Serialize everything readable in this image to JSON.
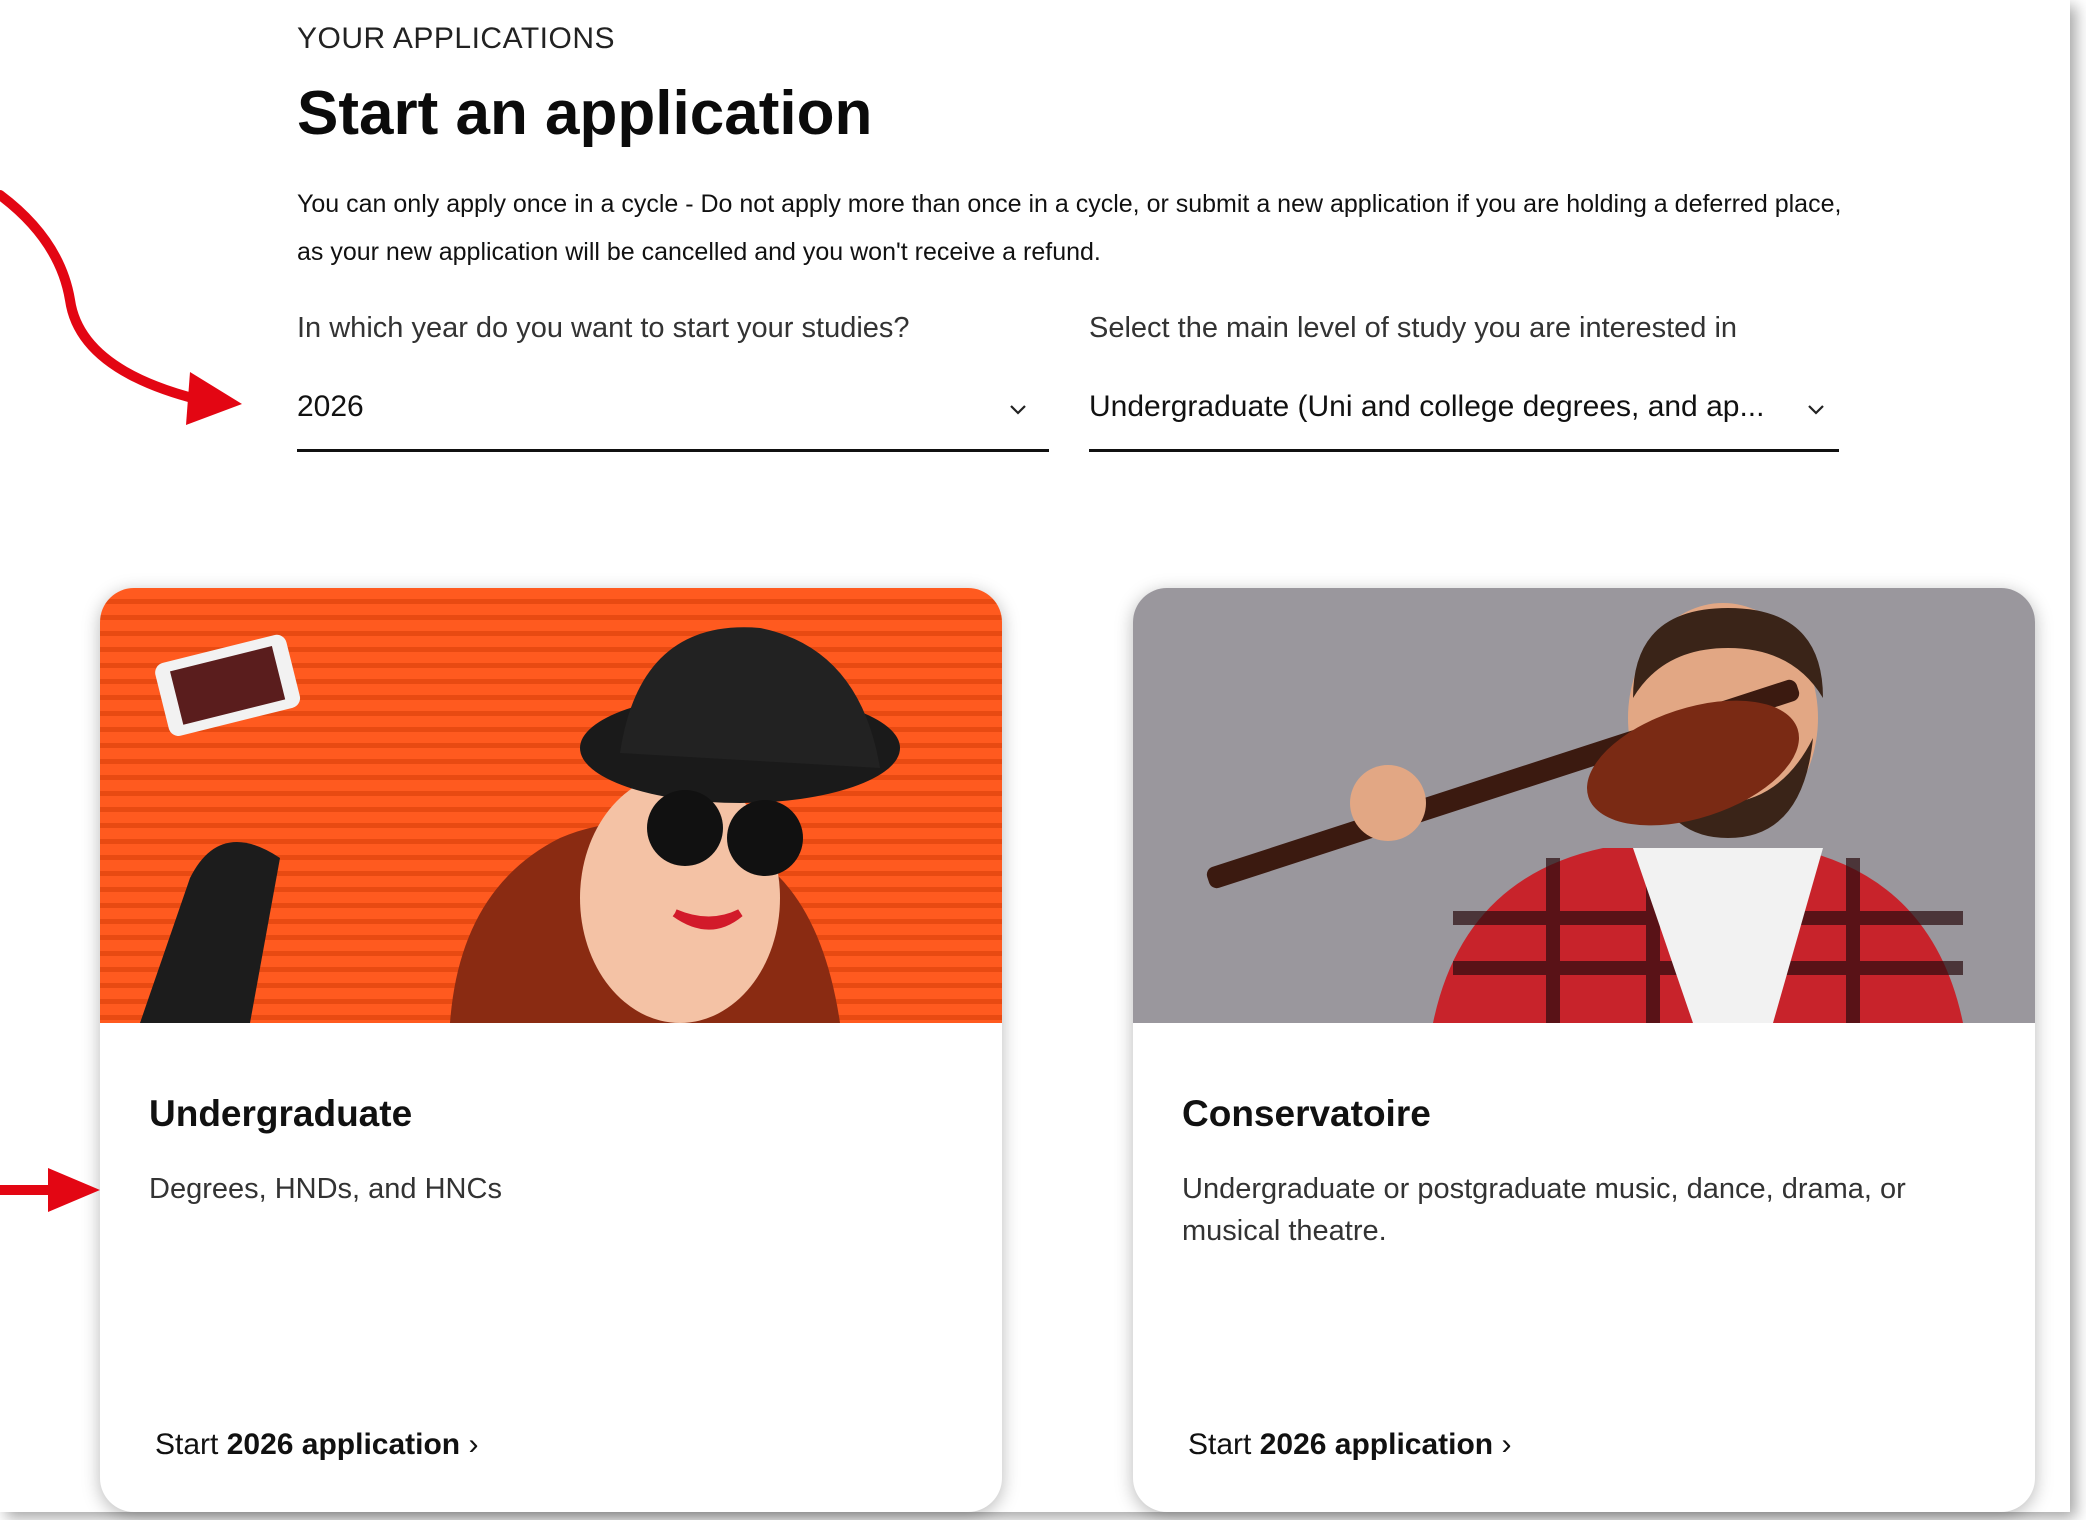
{
  "header": {
    "eyebrow": "YOUR APPLICATIONS",
    "title": "Start an application",
    "notice": "You can only apply once in a cycle - Do not apply more than once in a cycle, or submit a new application if you are holding a deferred place, as your new application will be cancelled and you won't receive a refund."
  },
  "year_select": {
    "label": "In which year do you want to start your studies?",
    "value": "2026"
  },
  "level_select": {
    "label": "Select the main level of study you are interested in",
    "value": "Undergraduate (Uni and college degrees, and ap..."
  },
  "cards": [
    {
      "title": "Undergraduate",
      "description": "Degrees, HNDs, and HNCs",
      "link_prefix": "Start ",
      "link_bold": "2026 application",
      "link_suffix": " ›"
    },
    {
      "title": "Conservatoire",
      "description": "Undergraduate or postgraduate music, dance, drama, or musical theatre.",
      "link_prefix": "Start ",
      "link_bold": "2026 application",
      "link_suffix": " ›"
    }
  ],
  "colors": {
    "annotation_arrow": "#e30613",
    "photo1_bg": "#ff5a1f",
    "photo2_bg": "#9a979d"
  }
}
